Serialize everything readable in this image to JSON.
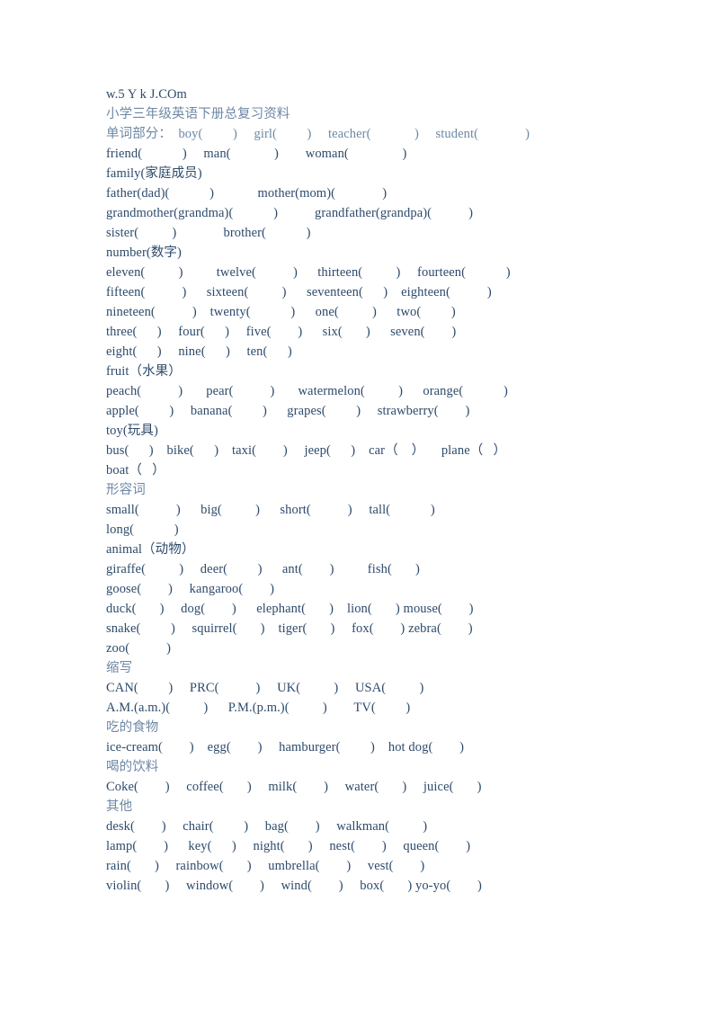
{
  "document": {
    "site_mark": "w.5 Y k J.COm",
    "title": "小学三年级英语下册总复习资料",
    "text_color_english": "#2d4a6b",
    "text_color_chinese_heading": "#6d88a5",
    "background_color": "#ffffff",
    "lines": [
      {
        "id": "site-mark",
        "style": "site-mark",
        "text": "w.5 Y k J.COm"
      },
      {
        "id": "doc-title",
        "style": "heading-cn",
        "text": "小学三年级英语下册总复习资料"
      },
      {
        "id": "words-1",
        "style": "heading-cn",
        "text": "单词部分：  boy(         )     girl(         )     teacher(             )     student(              )"
      },
      {
        "id": "words-2",
        "style": "body",
        "text": "friend(            )     man(             )        woman(                )"
      },
      {
        "id": "family-heading",
        "style": "body",
        "text": "family(家庭成员)"
      },
      {
        "id": "family-1",
        "style": "body",
        "text": "father(dad)(            )             mother(mom)(              )"
      },
      {
        "id": "family-2",
        "style": "body",
        "text": "grandmother(grandma)(            )           grandfather(grandpa)(           )"
      },
      {
        "id": "family-3",
        "style": "body",
        "text": "sister(          )              brother(            )"
      },
      {
        "id": "number-heading",
        "style": "body",
        "text": "number(数字)"
      },
      {
        "id": "number-1",
        "style": "body",
        "text": "eleven(          )          twelve(           )      thirteen(          )     fourteen(            )"
      },
      {
        "id": "number-2",
        "style": "body",
        "text": "fifteen(           )      sixteen(          )      seventeen(      )    eighteen(           )"
      },
      {
        "id": "number-3",
        "style": "body",
        "text": "nineteen(           )    twenty(            )      one(          )      two(         )"
      },
      {
        "id": "number-4",
        "style": "body",
        "text": "three(      )     four(      )     five(        )      six(       )      seven(        )"
      },
      {
        "id": "number-5",
        "style": "body",
        "text": "eight(      )     nine(      )     ten(      )"
      },
      {
        "id": "fruit-heading",
        "style": "body",
        "text": "fruit（水果）"
      },
      {
        "id": "fruit-1",
        "style": "body",
        "text": "peach(           )       pear(           )       watermelon(          )      orange(            )"
      },
      {
        "id": "fruit-2",
        "style": "body",
        "text": "apple(         )     banana(         )      grapes(         )     strawberry(        )"
      },
      {
        "id": "toy-heading",
        "style": "body",
        "text": "toy(玩具)"
      },
      {
        "id": "toy-1",
        "style": "body",
        "text": "bus(      )    bike(      )    taxi(        )     jeep(      )    car（    ）     plane（   ）"
      },
      {
        "id": "toy-2",
        "style": "body",
        "text": "boat（   ）"
      },
      {
        "id": "adj-heading",
        "style": "heading-cn",
        "text": "形容词"
      },
      {
        "id": "adj-1",
        "style": "body",
        "text": "small(           )      big(          )      short(           )     tall(            )"
      },
      {
        "id": "adj-2",
        "style": "body",
        "text": "long(            )"
      },
      {
        "id": "animal-heading",
        "style": "body",
        "text": "animal（动物）"
      },
      {
        "id": "animal-1",
        "style": "body",
        "text": "giraffe(          )     deer(         )      ant(        )          fish(       )"
      },
      {
        "id": "animal-2",
        "style": "body",
        "text": "goose(        )     kangaroo(        )"
      },
      {
        "id": "animal-3",
        "style": "body",
        "text": "duck(       )     dog(        )      elephant(       )    lion(       ) mouse(        )"
      },
      {
        "id": "animal-4",
        "style": "body",
        "text": "snake(         )     squirrel(       )    tiger(       )     fox(        ) zebra(        )"
      },
      {
        "id": "animal-5",
        "style": "body",
        "text": "zoo(           )"
      },
      {
        "id": "abbrev-heading",
        "style": "heading-cn",
        "text": "缩写"
      },
      {
        "id": "abbrev-1",
        "style": "body",
        "text": "CAN(         )     PRC(           )     UK(          )     USA(          )"
      },
      {
        "id": "abbrev-2",
        "style": "body",
        "text": "A.M.(a.m.)(          )      P.M.(p.m.)(          )        TV(         )"
      },
      {
        "id": "food-heading",
        "style": "heading-cn",
        "text": "吃的食物"
      },
      {
        "id": "food-1",
        "style": "body",
        "text": "ice-cream(        )    egg(        )     hamburger(         )    hot dog(        )"
      },
      {
        "id": "drink-heading",
        "style": "heading-cn",
        "text": "喝的饮料"
      },
      {
        "id": "drink-1",
        "style": "body",
        "text": "Coke(        )     coffee(       )     milk(        )     water(       )     juice(       )"
      },
      {
        "id": "other-heading",
        "style": "heading-cn",
        "text": "其他"
      },
      {
        "id": "other-1",
        "style": "body",
        "text": "desk(        )     chair(         )     bag(        )     walkman(          )"
      },
      {
        "id": "other-2",
        "style": "body",
        "text": "lamp(        )      key(      )     night(       )     nest(        )     queen(        )"
      },
      {
        "id": "other-3",
        "style": "body",
        "text": "rain(       )     rainbow(       )     umbrella(        )     vest(        )"
      },
      {
        "id": "other-4",
        "style": "body",
        "text": "violin(       )     window(        )     wind(        )     box(       ) yo-yo(        )"
      }
    ]
  }
}
